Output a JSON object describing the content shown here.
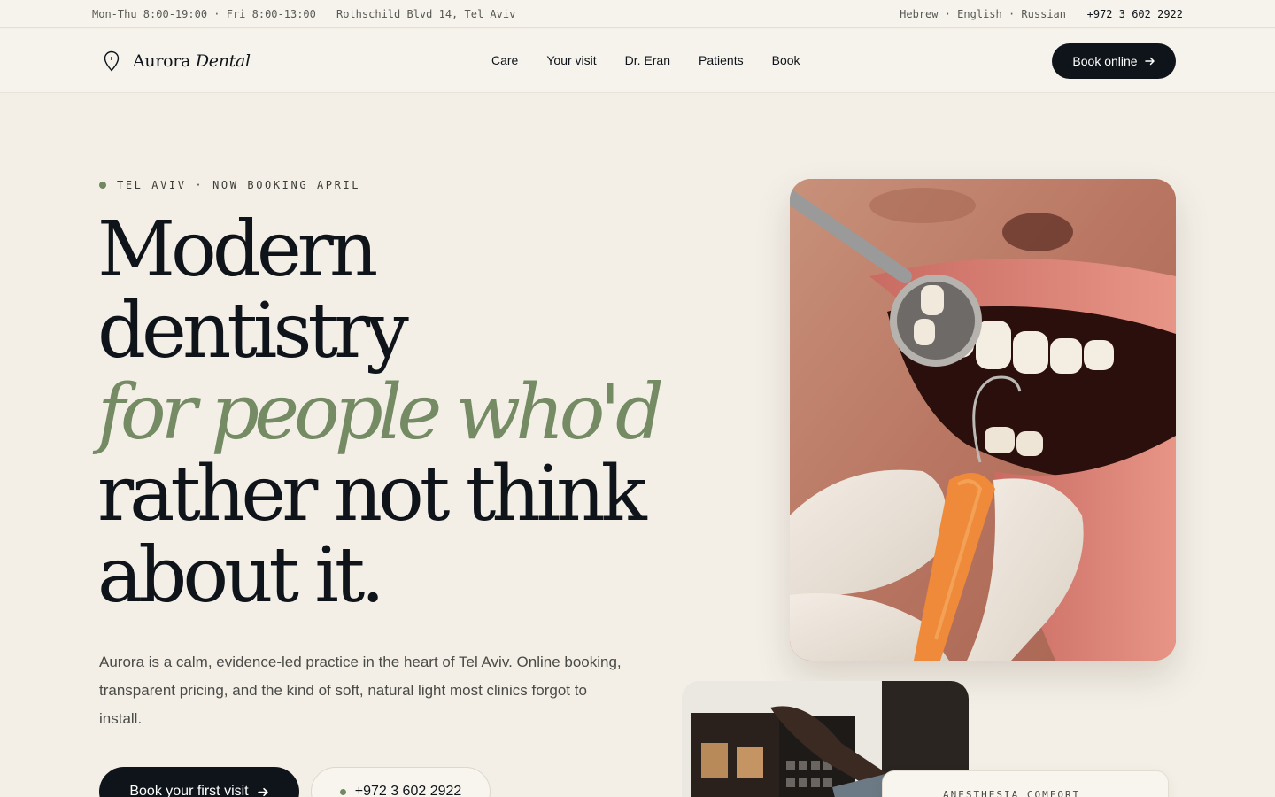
{
  "topbar": {
    "hours": "Mon-Thu 8:00-19:00 · Fri 8:00-13:00",
    "address": "Rothschild Blvd 14, Tel Aviv",
    "languages": "Hebrew · English · Russian",
    "phone": "+972 3 602 2922"
  },
  "nav": {
    "brand_primary": "Aurora",
    "brand_secondary": "Dental",
    "logo_icon": "tooth-pin-icon",
    "links": [
      "Care",
      "Your visit",
      "Dr. Eran",
      "Patients",
      "Book"
    ],
    "cta_label": "Book online",
    "cta_icon": "arrow-right-icon"
  },
  "hero": {
    "eyebrow": "TEL AVIV · NOW BOOKING APRIL",
    "headline_lines": [
      "Modern",
      "dentistry"
    ],
    "headline_accent": "for people who'd",
    "headline_rest": [
      "rather not think",
      "about it."
    ],
    "lede": "Aurora is a calm, evidence-led practice in the heart of Tel Aviv. Online booking, transparent pricing, and the kind of soft, natural light most clinics forgot to install.",
    "primary_cta": "Book your first visit",
    "phone_cta": "+972 3 602 2922",
    "accent_color": "#748b63"
  },
  "side": {
    "info_card_label": "ANESTHESIA COMFORT"
  }
}
